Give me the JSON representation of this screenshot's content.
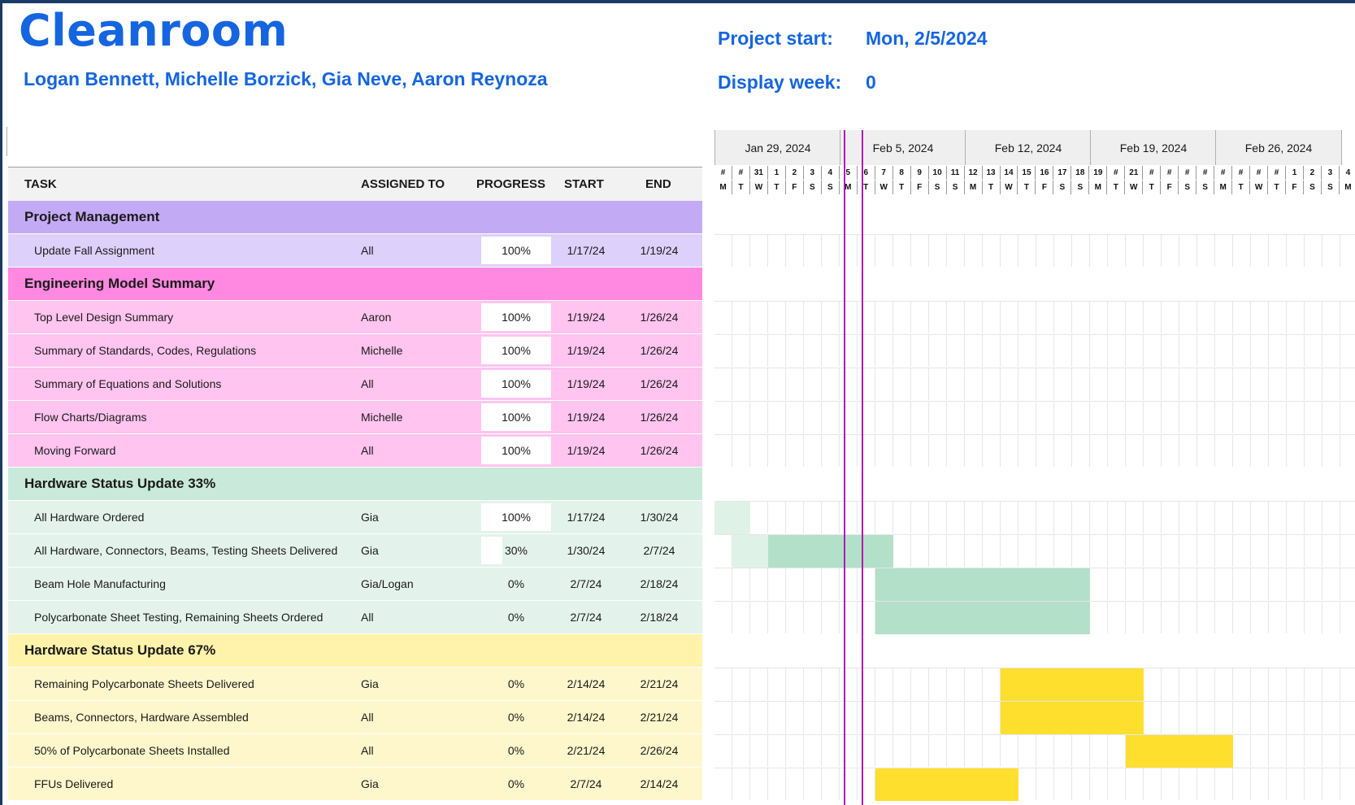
{
  "title": "Cleanroom",
  "authors": "Logan Bennett, Michelle Borzick, Gia Neve, Aaron Reynoza",
  "project_start_label": "Project start:",
  "project_start_value": "Mon, 2/5/2024",
  "display_week_label": "Display week:",
  "display_week_value": "0",
  "columns": {
    "task": "TASK",
    "assigned": "ASSIGNED TO",
    "progress": "PROGRESS",
    "start": "START",
    "end": "END"
  },
  "weeks": [
    "Jan 29, 2024",
    "Feb 5, 2024",
    "Feb 12, 2024",
    "Feb 19, 2024",
    "Feb 26, 2024"
  ],
  "day_numbers": [
    "#",
    "#",
    "31",
    "1",
    "2",
    "3",
    "4",
    "5",
    "6",
    "7",
    "8",
    "9",
    "10",
    "11",
    "12",
    "13",
    "14",
    "15",
    "16",
    "17",
    "18",
    "19",
    "#",
    "21",
    "#",
    "#",
    "#",
    "#",
    "#",
    "#",
    "#",
    "#",
    "1",
    "2",
    "3",
    "4"
  ],
  "day_letters": [
    "M",
    "T",
    "W",
    "T",
    "F",
    "S",
    "S",
    "M",
    "T",
    "W",
    "T",
    "F",
    "S",
    "S",
    "M",
    "T",
    "W",
    "T",
    "F",
    "S",
    "S",
    "M",
    "T",
    "W",
    "T",
    "F",
    "S",
    "S",
    "M",
    "T",
    "W",
    "T",
    "F",
    "S",
    "S",
    "M"
  ],
  "colors": {
    "accent": "#1565e0",
    "pm_phase": "#c3aaf5",
    "pm_task": "#ddd0fb",
    "eng_phase": "#ff88e0",
    "eng_task": "#ffc4f0",
    "hw1_phase": "#c9e9da",
    "hw1_task": "#e3f3eb",
    "hw1_bar": "#b2e0c8",
    "hw1_bar_done": "#dff2e8",
    "hw2_phase": "#fff2aa",
    "hw2_task": "#fff7cc",
    "hw2_bar": "#ffdf2e",
    "today_line": "#b01ab0"
  },
  "rows": [
    {
      "kind": "phase",
      "name": "Project Management",
      "color": "#c3aaf5"
    },
    {
      "kind": "task",
      "name": "Update Fall Assignment",
      "assigned": "All",
      "progress": "100%",
      "pct": 100,
      "start": "1/17/24",
      "end": "1/19/24",
      "color": "#ddd0fb",
      "bar": null
    },
    {
      "kind": "phase",
      "name": "Engineering Model Summary",
      "color": "#ff88e0"
    },
    {
      "kind": "task",
      "name": "Top Level Design Summary",
      "assigned": "Aaron",
      "progress": "100%",
      "pct": 100,
      "start": "1/19/24",
      "end": "1/26/24",
      "color": "#ffc4f0",
      "bar": null
    },
    {
      "kind": "task",
      "name": "Summary of Standards, Codes, Regulations",
      "assigned": "Michelle",
      "progress": "100%",
      "pct": 100,
      "start": "1/19/24",
      "end": "1/26/24",
      "color": "#ffc4f0",
      "bar": null
    },
    {
      "kind": "task",
      "name": "Summary of Equations and Solutions",
      "assigned": "All",
      "progress": "100%",
      "pct": 100,
      "start": "1/19/24",
      "end": "1/26/24",
      "color": "#ffc4f0",
      "bar": null
    },
    {
      "kind": "task",
      "name": "Flow Charts/Diagrams",
      "assigned": "Michelle",
      "progress": "100%",
      "pct": 100,
      "start": "1/19/24",
      "end": "1/26/24",
      "color": "#ffc4f0",
      "bar": null
    },
    {
      "kind": "task",
      "name": "Moving Forward",
      "assigned": "All",
      "progress": "100%",
      "pct": 100,
      "start": "1/19/24",
      "end": "1/26/24",
      "color": "#ffc4f0",
      "bar": null
    },
    {
      "kind": "phase",
      "name": "Hardware Status Update 33%",
      "color": "#c9e9da"
    },
    {
      "kind": "task",
      "name": "All Hardware Ordered",
      "assigned": "Gia",
      "progress": "100%",
      "pct": 100,
      "start": "1/17/24",
      "end": "1/30/24",
      "color": "#e3f3eb",
      "bar": {
        "from": 0,
        "to": 2,
        "done": 2,
        "col": "#b2e0c8",
        "donecol": "#dff2e8"
      }
    },
    {
      "kind": "task",
      "name": "All Hardware, Connectors, Beams, Testing Sheets Delivered",
      "assigned": "Gia",
      "progress": "30%",
      "pct": 30,
      "start": "1/30/24",
      "end": "2/7/24",
      "color": "#e3f3eb",
      "bar": {
        "from": 1,
        "to": 10,
        "done": 3,
        "col": "#b2e0c8",
        "donecol": "#dff2e8"
      }
    },
    {
      "kind": "task",
      "name": "Beam Hole Manufacturing",
      "assigned": "Gia/Logan",
      "progress": "0%",
      "pct": 0,
      "start": "2/7/24",
      "end": "2/18/24",
      "color": "#e3f3eb",
      "bar": {
        "from": 9,
        "to": 21,
        "done": 0,
        "col": "#b2e0c8",
        "donecol": "#dff2e8"
      }
    },
    {
      "kind": "task",
      "name": "Polycarbonate Sheet Testing, Remaining Sheets Ordered",
      "assigned": "All",
      "progress": "0%",
      "pct": 0,
      "start": "2/7/24",
      "end": "2/18/24",
      "color": "#e3f3eb",
      "bar": {
        "from": 9,
        "to": 21,
        "done": 0,
        "col": "#b2e0c8",
        "donecol": "#dff2e8"
      }
    },
    {
      "kind": "phase",
      "name": "Hardware Status Update 67%",
      "color": "#fff2aa"
    },
    {
      "kind": "task",
      "name": "Remaining Polycarbonate Sheets Delivered",
      "assigned": "Gia",
      "progress": "0%",
      "pct": 0,
      "start": "2/14/24",
      "end": "2/21/24",
      "color": "#fff7cc",
      "bar": {
        "from": 16,
        "to": 24,
        "done": 0,
        "col": "#ffdf2e",
        "donecol": "#ffdf2e"
      }
    },
    {
      "kind": "task",
      "name": "Beams, Connectors, Hardware Assembled",
      "assigned": "All",
      "progress": "0%",
      "pct": 0,
      "start": "2/14/24",
      "end": "2/21/24",
      "color": "#fff7cc",
      "bar": {
        "from": 16,
        "to": 24,
        "done": 0,
        "col": "#ffdf2e",
        "donecol": "#ffdf2e"
      }
    },
    {
      "kind": "task",
      "name": "50% of Polycarbonate Sheets Installed",
      "assigned": "All",
      "progress": "0%",
      "pct": 0,
      "start": "2/21/24",
      "end": "2/26/24",
      "color": "#fff7cc",
      "bar": {
        "from": 23,
        "to": 29,
        "done": 0,
        "col": "#ffdf2e",
        "donecol": "#ffdf2e"
      }
    },
    {
      "kind": "task",
      "name": "FFUs Delivered",
      "assigned": "Gia",
      "progress": "0%",
      "pct": 0,
      "start": "2/7/24",
      "end": "2/14/24",
      "color": "#fff7cc",
      "bar": {
        "from": 9,
        "to": 17,
        "done": 0,
        "col": "#ffdf2e",
        "donecol": "#ffdf2e"
      }
    }
  ]
}
